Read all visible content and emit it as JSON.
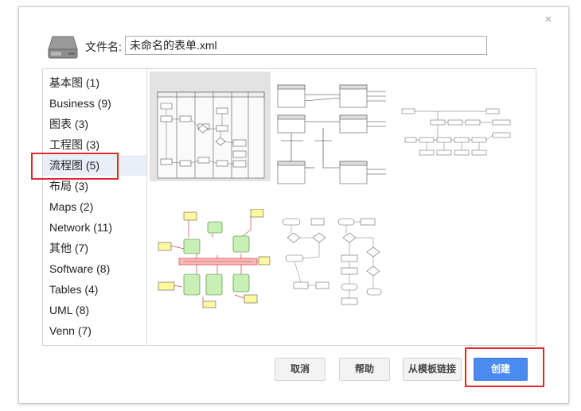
{
  "dialog": {
    "close_symbol": "×",
    "filename_label": "文件名:",
    "filename_value": "未命名的表单.xml"
  },
  "categories": [
    {
      "label": "基本图 (1)"
    },
    {
      "label": "Business (9)"
    },
    {
      "label": "图表 (3)"
    },
    {
      "label": "工程图 (3)"
    },
    {
      "label": "流程图 (5)",
      "selected": true
    },
    {
      "label": "布局 (3)"
    },
    {
      "label": "Maps (2)"
    },
    {
      "label": "Network (11)"
    },
    {
      "label": "其他 (7)"
    },
    {
      "label": "Software (8)"
    },
    {
      "label": "Tables (4)"
    },
    {
      "label": "UML (8)"
    },
    {
      "label": "Venn (7)"
    }
  ],
  "templates": [
    {
      "name": "swimlane-flowchart"
    },
    {
      "name": "entity-diagram"
    },
    {
      "name": "process-map"
    },
    {
      "name": "highlighted-flowchart"
    },
    {
      "name": "decision-flowchart"
    }
  ],
  "buttons": {
    "cancel": "取消",
    "help": "帮助",
    "from_link": "从模板链接",
    "create": "创建"
  },
  "colors": {
    "highlight": "#e5262b",
    "primary": "#4a8bef",
    "selected_category": "#e9eef9"
  },
  "icons": {
    "file": "drive-icon",
    "close": "close-icon"
  }
}
